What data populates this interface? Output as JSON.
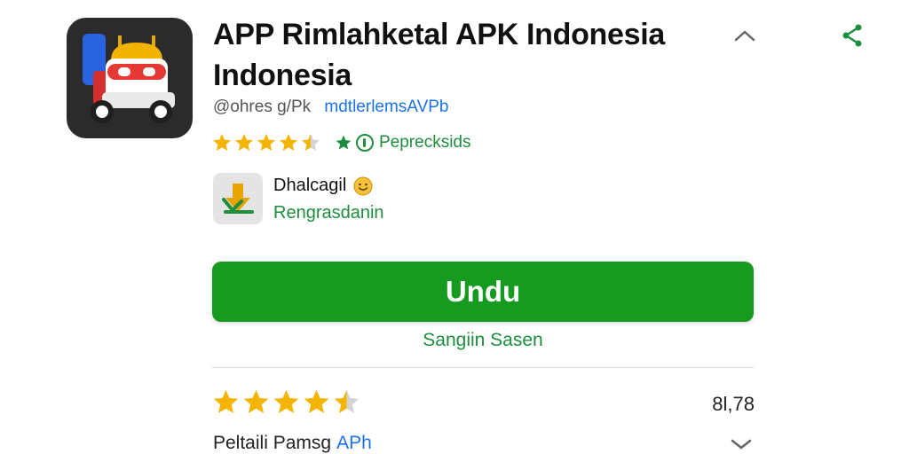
{
  "app": {
    "title": "APP Rimlahketal APK Indonesia Indonesia",
    "developer_handle": "@ohres g/Pk",
    "developer_link": "mdtlerlemsAVPb",
    "rating_stars": 4.5,
    "badge_label": "Peprecksids"
  },
  "installer": {
    "name": "Dhalcagil",
    "status": "Rengrasdanin"
  },
  "download": {
    "button_label": "Undu",
    "sub_link": "Sangiin Sasen"
  },
  "summary": {
    "rating_stars": 4.5,
    "score": "8l,78"
  },
  "details": {
    "label": "Peltaili Pamsg",
    "link": "APh"
  },
  "colors": {
    "accent_green": "#169a1f",
    "link_blue": "#1a73e8",
    "star_gold": "#f4b400"
  }
}
